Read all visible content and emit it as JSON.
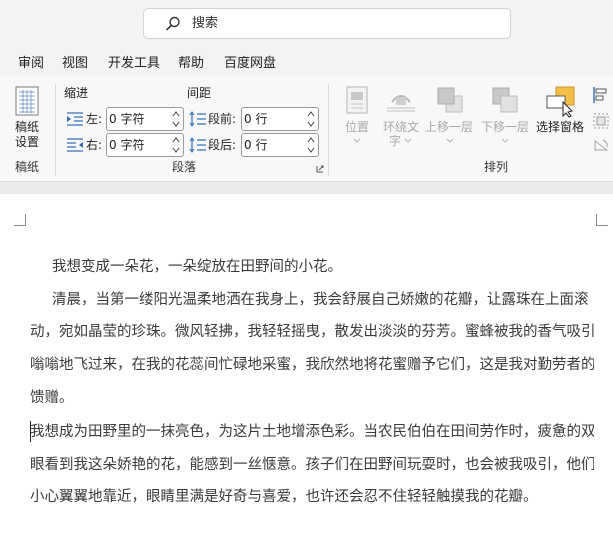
{
  "search": {
    "placeholder": "搜索"
  },
  "tabs": [
    "审阅",
    "视图",
    "开发工具",
    "帮助",
    "百度网盘"
  ],
  "ribbon": {
    "gaozhi": {
      "button_line1": "稿纸",
      "button_line2": "设置",
      "group": "稿纸"
    },
    "paragraph": {
      "indent_header": "缩进",
      "spacing_header": "间距",
      "left_label": "左:",
      "right_label": "右:",
      "before_label": "段前:",
      "after_label": "段后:",
      "left_value": "0 字符",
      "right_value": "0 字符",
      "before_value": "0 行",
      "after_value": "0 行",
      "group": "段落"
    },
    "arrange": {
      "position": "位置",
      "wrap_line1": "环绕文",
      "wrap_line2": "字",
      "bring_forward": "上移一层",
      "send_backward": "下移一层",
      "selection_pane": "选择窗格",
      "group": "排列"
    }
  },
  "document": {
    "lines": [
      "我想变成一朵花，一朵绽放在田野间的小花。",
      "清晨，当第一缕阳光温柔地洒在我身上，我会舒展自己娇嫩的花瓣，让露珠在上面滚",
      "动，宛如晶莹的珍珠。微风轻拂，我轻轻摇曳，散发出淡淡的芬芳。蜜蜂被我的香气吸引，",
      "嗡嗡地飞过来，在我的花蕊间忙碌地采蜜，我欣然地将花蜜赠予它们，这是我对勤劳者的",
      "馈赠。",
      "我想成为田野里的一抹亮色，为这片土地增添色彩。当农民伯伯在田间劳作时，疲惫的双",
      "眼看到我这朵娇艳的花，能感到一丝惬意。孩子们在田野间玩耍时，也会被我吸引，他们",
      "小心翼翼地靠近，眼睛里满是好奇与喜爱，也许还会忍不住轻轻触摸我的花瓣。"
    ]
  },
  "colors": {
    "accent": "#f5c04a",
    "page": "#ffffff",
    "ribbon": "#f8f8f8"
  }
}
